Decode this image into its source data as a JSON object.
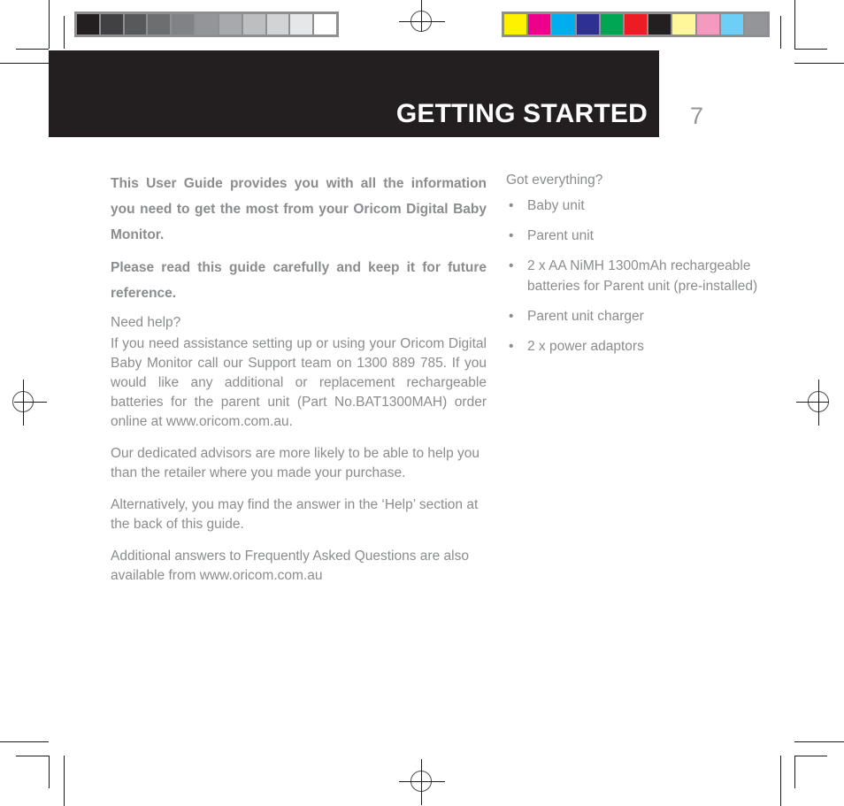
{
  "header": {
    "title": "GETTING STARTED",
    "page_number": "7",
    "banner_color": "#231f20",
    "title_color": "#ffffff",
    "page_number_color": "#939598"
  },
  "body_text_color": "#8a8c8e",
  "left_column": {
    "lead_paragraphs": [
      "This User Guide provides you with all the information you need to get the most from your Oricom Digital Baby Monitor.",
      "Please read this guide carefully and keep it for future reference."
    ],
    "help_heading": "Need help?",
    "paragraphs": [
      "If you need assistance setting up or using your Oricom Digital Baby Monitor call our Support team on 1300 889 785. If you would like any additional or replacement rechargeable batteries for the parent unit (Part No.BAT1300MAH) order online at www.oricom.com.au.",
      "Our dedicated advisors are more likely to be able to help you than the retailer where you made your purchase.",
      "Alternatively, you may find the answer in the ‘Help’ section at the back of this guide.",
      "Additional answers to Frequently Asked Questions are also available from www.oricom.com.au"
    ]
  },
  "right_column": {
    "heading": "Got everything?",
    "bullet_char": "•",
    "items": [
      "Baby unit",
      "Parent unit",
      "2 x AA NiMH 1300mAh rechargeable batteries for Parent unit (pre-installed)",
      "Parent unit charger",
      "2 x power adaptors"
    ]
  },
  "calibration": {
    "grayscale_label": "grayscale-calibration-strip",
    "grayscale_patches": [
      "#231f20",
      "#414042",
      "#58595b",
      "#6d6e70",
      "#808285",
      "#939598",
      "#a7a9ac",
      "#bcbec0",
      "#d1d3d4",
      "#e6e7e8",
      "#ffffff"
    ],
    "color_label": "color-calibration-strip",
    "color_patches": [
      "#fff200",
      "#ec008c",
      "#00aeef",
      "#2e3192",
      "#00a651",
      "#ed1c24",
      "#231f20",
      "#fff79a",
      "#f49ac1",
      "#6dcff6",
      "#939598"
    ],
    "border_color": "#8d8f91"
  }
}
